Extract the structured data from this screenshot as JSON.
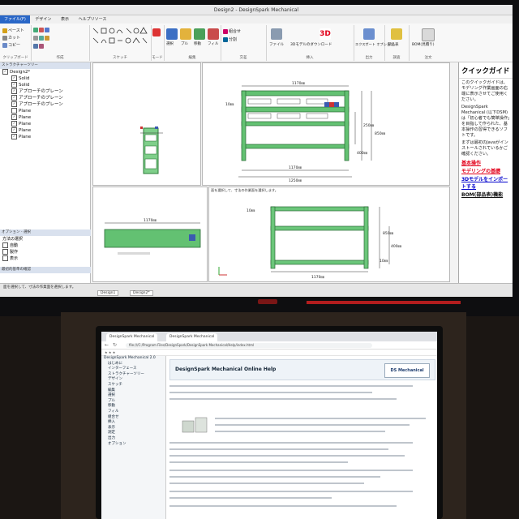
{
  "top_app": {
    "title": "Design2 - DesignSpark Mechanical",
    "tabs": [
      "ファイル(F)",
      "デザイン",
      "表示",
      "ヘルプリソース"
    ],
    "ribbon_groups": [
      "クリップボード",
      "作成",
      "スケッチ",
      "モード",
      "編集",
      "交差",
      "挿入",
      "出力",
      "調査",
      "注文"
    ],
    "ribbon_items": {
      "clipboard": [
        "ペースト",
        "カット",
        "コピー"
      ],
      "edit": [
        "選択",
        "プル",
        "移動",
        "フィル"
      ],
      "intersect": [
        "組合せ",
        "分割"
      ],
      "insert": [
        "ファイル",
        "3Dモデルのダウンロード"
      ],
      "output": [
        "エクスポート オプション"
      ],
      "investigate": [
        "部品表"
      ],
      "order": [
        "BOM(見積り)"
      ]
    },
    "structure_header": "ストラクチャーツリー",
    "tree": [
      {
        "label": "Design2*",
        "checked": true
      },
      {
        "label": "Solid",
        "checked": true
      },
      {
        "label": "Solid",
        "checked": true
      },
      {
        "label": "アプローチのプレーン",
        "checked": true
      },
      {
        "label": "アプローチのプレーン",
        "checked": true
      },
      {
        "label": "アプローチのプレーン",
        "checked": true
      },
      {
        "label": "Plane",
        "checked": false
      },
      {
        "label": "Plane",
        "checked": true
      },
      {
        "label": "Plane",
        "checked": true
      },
      {
        "label": "Plane",
        "checked": true
      },
      {
        "label": "Plane",
        "checked": true
      }
    ],
    "options_header": "オプション - 選択",
    "options": [
      "方法の選択",
      "自動",
      "製作",
      "表示"
    ],
    "options_footer": "最初的基準の確認",
    "dimensions": {
      "top_view": [
        "1170㎜",
        "10㎜",
        "250㎜",
        "850㎜",
        "400㎜",
        "1170㎜",
        "1250㎜"
      ],
      "bottom_view": [
        "10㎜",
        "850㎜",
        "400㎜",
        "10㎜",
        "1170㎜",
        "1170㎜"
      ]
    },
    "view_hint": "面を選択して、寸法の作業面を選択します。",
    "quick_guide": {
      "title": "クイックガイド",
      "paragraphs": [
        "このクイックガイドは、モデリング作業画面の右端に表示させてご使用ください。",
        "DesignSpark Mechanical (以下DSM)は「初心者でも簡単操作」を目指して作られた、基本操作の習得できるソフトです。",
        "まずは最初のJavaがインストールされているかご確認ください。"
      ],
      "links": [
        "基本操作",
        "モデリングの基礎",
        "3Dモデルをインポートする",
        "BOM(部品表)機能"
      ]
    },
    "status_text": "面を選択して、寸法の作業面を選択します。",
    "doc_tabs": [
      "Design1",
      "Design2*"
    ]
  },
  "laptop": {
    "browser_tabs": [
      "DesignSpark Mechanical",
      "DesignSpark Mechanical"
    ],
    "address": "file:///C:/Program Files/DesignSpark/DesignSpark Mechanical/Help/index.html",
    "page_title": "DesignSpark Mechanical Online Help",
    "logo": "DS Mechanical",
    "sidebar": [
      "DesignSpark Mechanical 2.0",
      "はじめに",
      "インターフェース",
      "ストラクチャーツリー",
      "デザイン",
      "スケッチ",
      "編集",
      "選択",
      "プル",
      "移動",
      "フィル",
      "組合せ",
      "挿入",
      "表示",
      "測定",
      "出力",
      "オプション"
    ]
  },
  "colors": {
    "accent": "#2a67c7",
    "model_green": "#59c06a",
    "dim_line": "#3a3a3a"
  }
}
